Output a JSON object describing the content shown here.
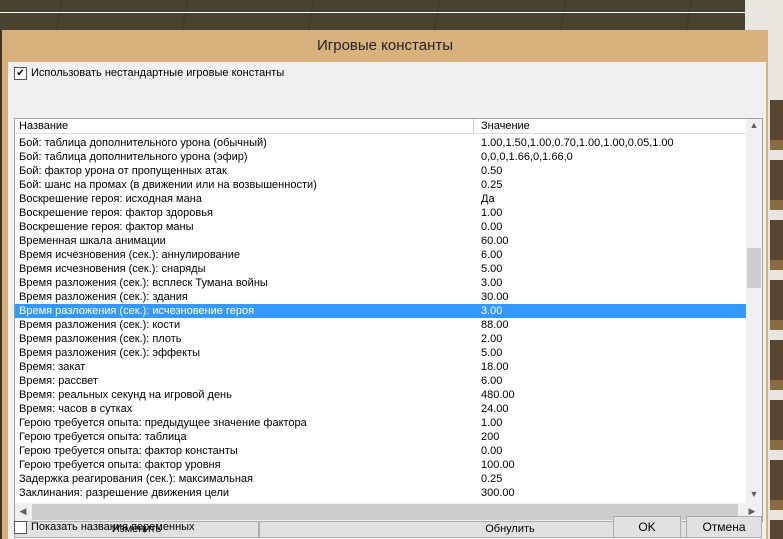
{
  "dialog": {
    "title": "Игровые константы",
    "use_custom_label": "Использовать нестандартные игровые константы",
    "use_custom_checked": true,
    "columns": {
      "name": "Название",
      "value": "Значение"
    },
    "rows": [
      {
        "name": "Бой: таблица дополнительного урона (обычный)",
        "value": "1.00,1.50,1.00,0.70,1.00,1.00,0.05,1.00"
      },
      {
        "name": "Бой: таблица дополнительного урона (эфир)",
        "value": "0,0,0,1.66,0,1.66,0"
      },
      {
        "name": "Бой: фактор урона от пропущенных атак",
        "value": "0.50"
      },
      {
        "name": "Бой: шанс на промах (в движении или на возвышенности)",
        "value": "0.25"
      },
      {
        "name": "Воскрешение героя: исходная мана",
        "value": "Да"
      },
      {
        "name": "Воскрешение героя: фактор здоровья",
        "value": "1.00"
      },
      {
        "name": "Воскрешение героя: фактор маны",
        "value": "0.00"
      },
      {
        "name": "Временная шкала анимации",
        "value": "60.00"
      },
      {
        "name": "Время исчезновения (сек.): аннулирование",
        "value": "6.00"
      },
      {
        "name": "Время исчезновения (сек.): снаряды",
        "value": "5.00"
      },
      {
        "name": "Время разложения (сек.): всплеск Тумана войны",
        "value": "3.00"
      },
      {
        "name": "Время разложения (сек.): здания",
        "value": "30.00"
      },
      {
        "name": "Время разложения (сек.): исчезновение героя",
        "value": "3.00",
        "selected": true
      },
      {
        "name": "Время разложения (сек.): кости",
        "value": "88.00"
      },
      {
        "name": "Время разложения (сек.): плоть",
        "value": "2.00"
      },
      {
        "name": "Время разложения (сек.): эффекты",
        "value": "5.00"
      },
      {
        "name": "Время: закат",
        "value": "18.00"
      },
      {
        "name": "Время: рассвет",
        "value": "6.00"
      },
      {
        "name": "Время: реальных секунд на игровой день",
        "value": "480.00"
      },
      {
        "name": "Время: часов в сутках",
        "value": "24.00"
      },
      {
        "name": "Герою требуется опыта: предыдущее значение фактора",
        "value": "1.00"
      },
      {
        "name": "Герою требуется опыта: таблица",
        "value": "200"
      },
      {
        "name": "Герою требуется опыта: фактор константы",
        "value": "0.00"
      },
      {
        "name": "Герою требуется опыта: фактор уровня",
        "value": "100.00"
      },
      {
        "name": "Задержка реагирования (сек.): максимальная",
        "value": "0.25"
      },
      {
        "name": "Заклинания: разрешение движения цели",
        "value": "300.00"
      }
    ],
    "edit_button": "Изменить",
    "reset_button": "Обнулить",
    "show_var_names_label": "Показать названия переменных",
    "show_var_names_checked": false,
    "ok_button": "OK",
    "cancel_button": "Отмена"
  },
  "colors": {
    "title_bar": "#d8b27c",
    "selection": "#3399ff"
  }
}
